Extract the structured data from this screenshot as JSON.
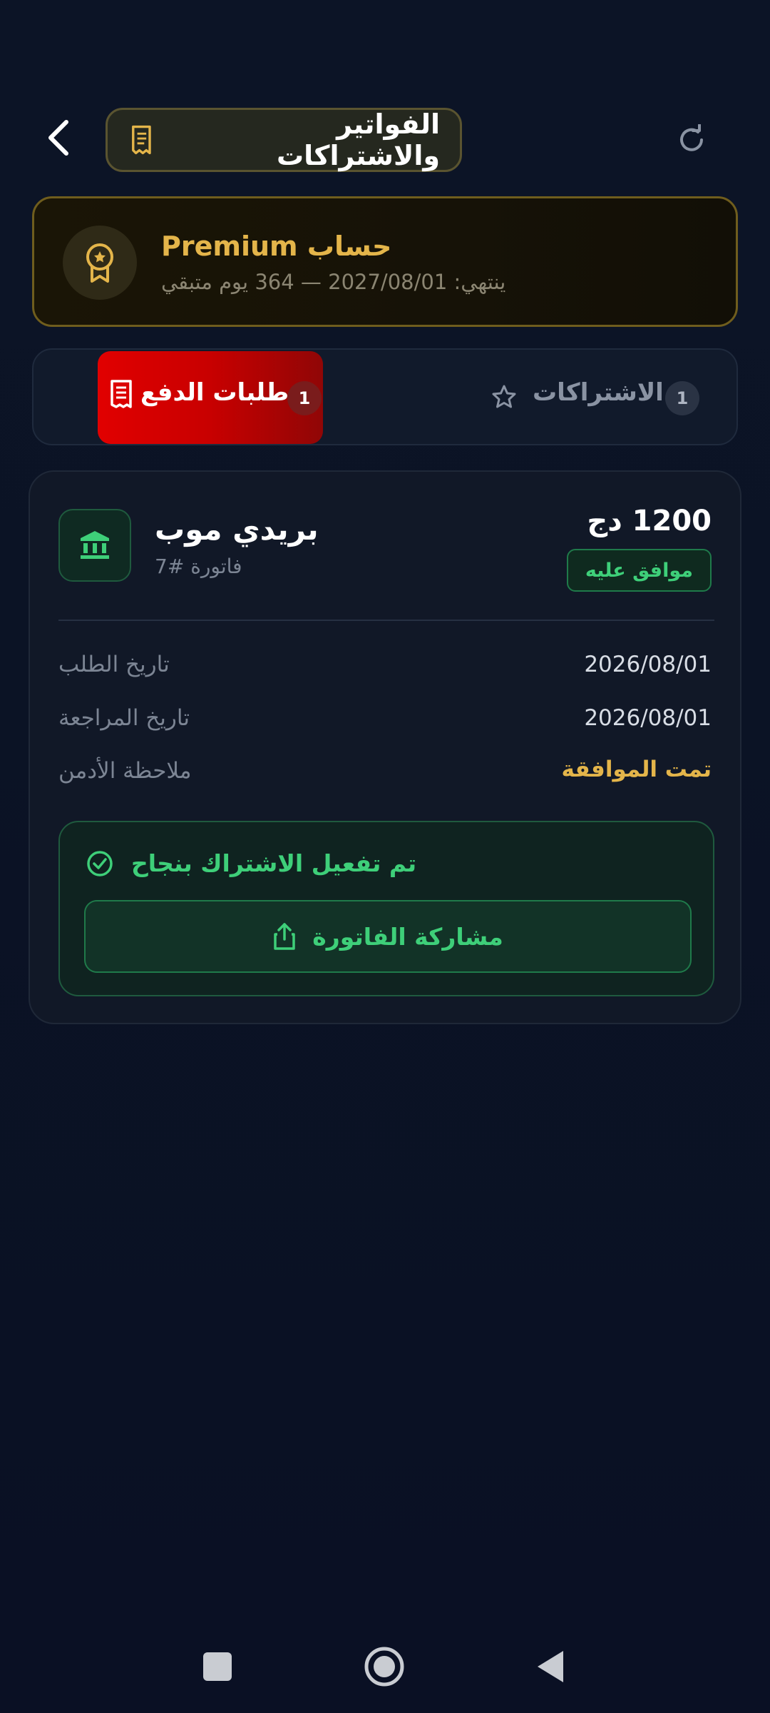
{
  "header": {
    "title": "الفواتير والاشتراكات",
    "back_icon": "chevron-left-icon",
    "refresh_icon": "refresh-icon",
    "title_icon": "receipt-icon"
  },
  "premium": {
    "title": "حساب Premium",
    "subtitle": "ينتهي: 2027/08/01 — 364 يوم متبقي",
    "icon": "medal-icon"
  },
  "tabs": {
    "payments": {
      "label": "طلبات الدفع",
      "count": "1",
      "active": true
    },
    "subscriptions": {
      "label": "الاشتراكات",
      "count": "1",
      "active": false
    }
  },
  "invoice": {
    "method_name": "بريدي موب",
    "invoice_number": "فاتورة #7",
    "amount": "1200 دج",
    "status": "موافق عليه",
    "rows": [
      {
        "label": "تاريخ الطلب",
        "value": "2026/08/01"
      },
      {
        "label": "تاريخ المراجعة",
        "value": "2026/08/01"
      },
      {
        "label": "ملاحظة الأدمن",
        "value": "تمت الموافقة"
      }
    ],
    "success_message": "تم تفعيل الاشتراك بنجاح",
    "share_label": "مشاركة الفاتورة"
  },
  "colors": {
    "accent_gold": "#e4b54a",
    "accent_green": "#3ecf79",
    "active_tab_red": "#e10000",
    "background": "#0b1325"
  }
}
